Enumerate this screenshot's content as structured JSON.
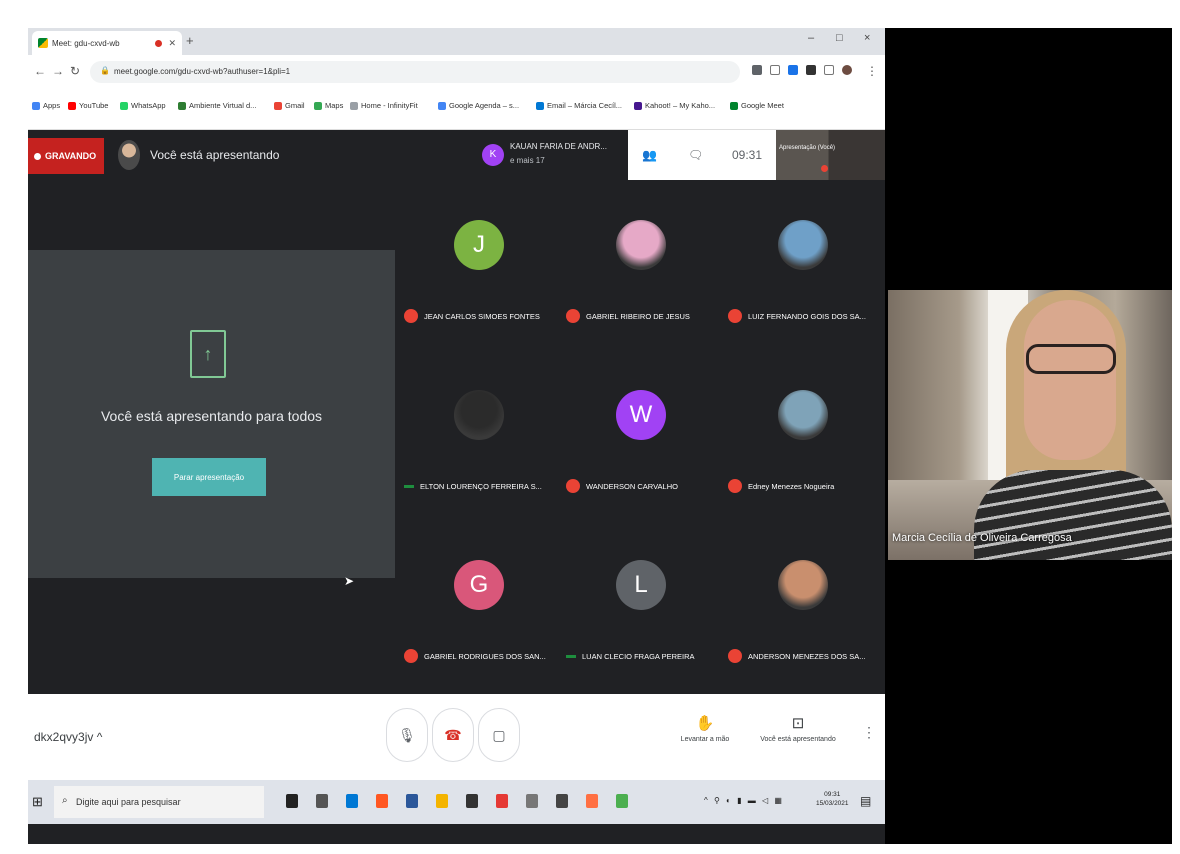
{
  "browser": {
    "tab_title": "Meet: gdu-cxvd-wb",
    "url": "meet.google.com/gdu-cxvd-wb?authuser=1&pli=1",
    "window_controls": [
      "–",
      "□",
      "×"
    ],
    "bookmarks": [
      {
        "label": "Apps",
        "color": "#4285f4"
      },
      {
        "label": "YouTube",
        "color": "#ff0000"
      },
      {
        "label": "WhatsApp",
        "color": "#25d366"
      },
      {
        "label": "Ambiente Virtual d...",
        "color": "#2e7d32"
      },
      {
        "label": "Gmail",
        "color": "#ea4335"
      },
      {
        "label": "Maps",
        "color": "#34a853"
      },
      {
        "label": "Home - InfinityFit",
        "color": "#9aa0a6"
      },
      {
        "label": "Google Agenda – s...",
        "color": "#4285f4"
      },
      {
        "label": "Email – Márcia Cecíl...",
        "color": "#0078d4"
      },
      {
        "label": "Kahoot! – My Kaho...",
        "color": "#46178f"
      },
      {
        "label": "Google Meet",
        "color": "#00832d"
      }
    ]
  },
  "meet": {
    "recording_label": "GRAVANDO",
    "presenting_label": "Você está apresentando",
    "participants_chip": {
      "initial": "K",
      "name": "KAUAN FARIA DE ANDR...",
      "more": "e mais 17"
    },
    "clock": "09:31",
    "self_view_label": "Apresentação (Você)",
    "presentation": {
      "message": "Você está apresentando para todos",
      "stop_button": "Parar apresentação"
    },
    "tiles": [
      {
        "name": "JEAN CARLOS SIMOES FONTES",
        "initial": "J",
        "color": "#7cb342",
        "muted": true
      },
      {
        "name": "GABRIEL RIBEIRO DE JESUS",
        "photo": "#e6a9c7",
        "muted": true
      },
      {
        "name": "LUIZ FERNANDO GOIS DOS SA...",
        "photo": "#6fa0c8",
        "muted": true
      },
      {
        "name": "ELTON LOURENÇO FERREIRA S...",
        "photo": "#2b2b2b",
        "muted": false
      },
      {
        "name": "WANDERSON CARVALHO",
        "initial": "W",
        "color": "#a142f4",
        "muted": true
      },
      {
        "name": "Edney Menezes Nogueira",
        "photo": "#7fa3b8",
        "muted": true
      },
      {
        "name": "GABRIEL RODRIGUES DOS SAN...",
        "initial": "G",
        "color": "#d9577a",
        "muted": true
      },
      {
        "name": "LUAN CLECIO FRAGA PEREIRA",
        "initial": "L",
        "color": "#5f6368",
        "muted": false
      },
      {
        "name": "ANDERSON MENEZES DOS SA...",
        "photo": "#c98f6e",
        "muted": true
      }
    ],
    "bottom_bar": {
      "meeting_code": "dkx2qvy3jv ^",
      "raise_hand": "Levantar a mão",
      "presenting": "Você está apresentando"
    }
  },
  "taskbar": {
    "search_placeholder": "Digite aqui para pesquisar",
    "time": "09:31",
    "date": "15/03/2021",
    "apps": [
      "#222222",
      "#555555",
      "#0078d4",
      "#ff5722",
      "#2b579a",
      "#f4b400",
      "#333333",
      "#e53935",
      "#777777",
      "#444444",
      "#ff7043",
      "#4caf50"
    ]
  },
  "webcam": {
    "name": "Marcia Cecília de Oliveira Carregosa"
  }
}
